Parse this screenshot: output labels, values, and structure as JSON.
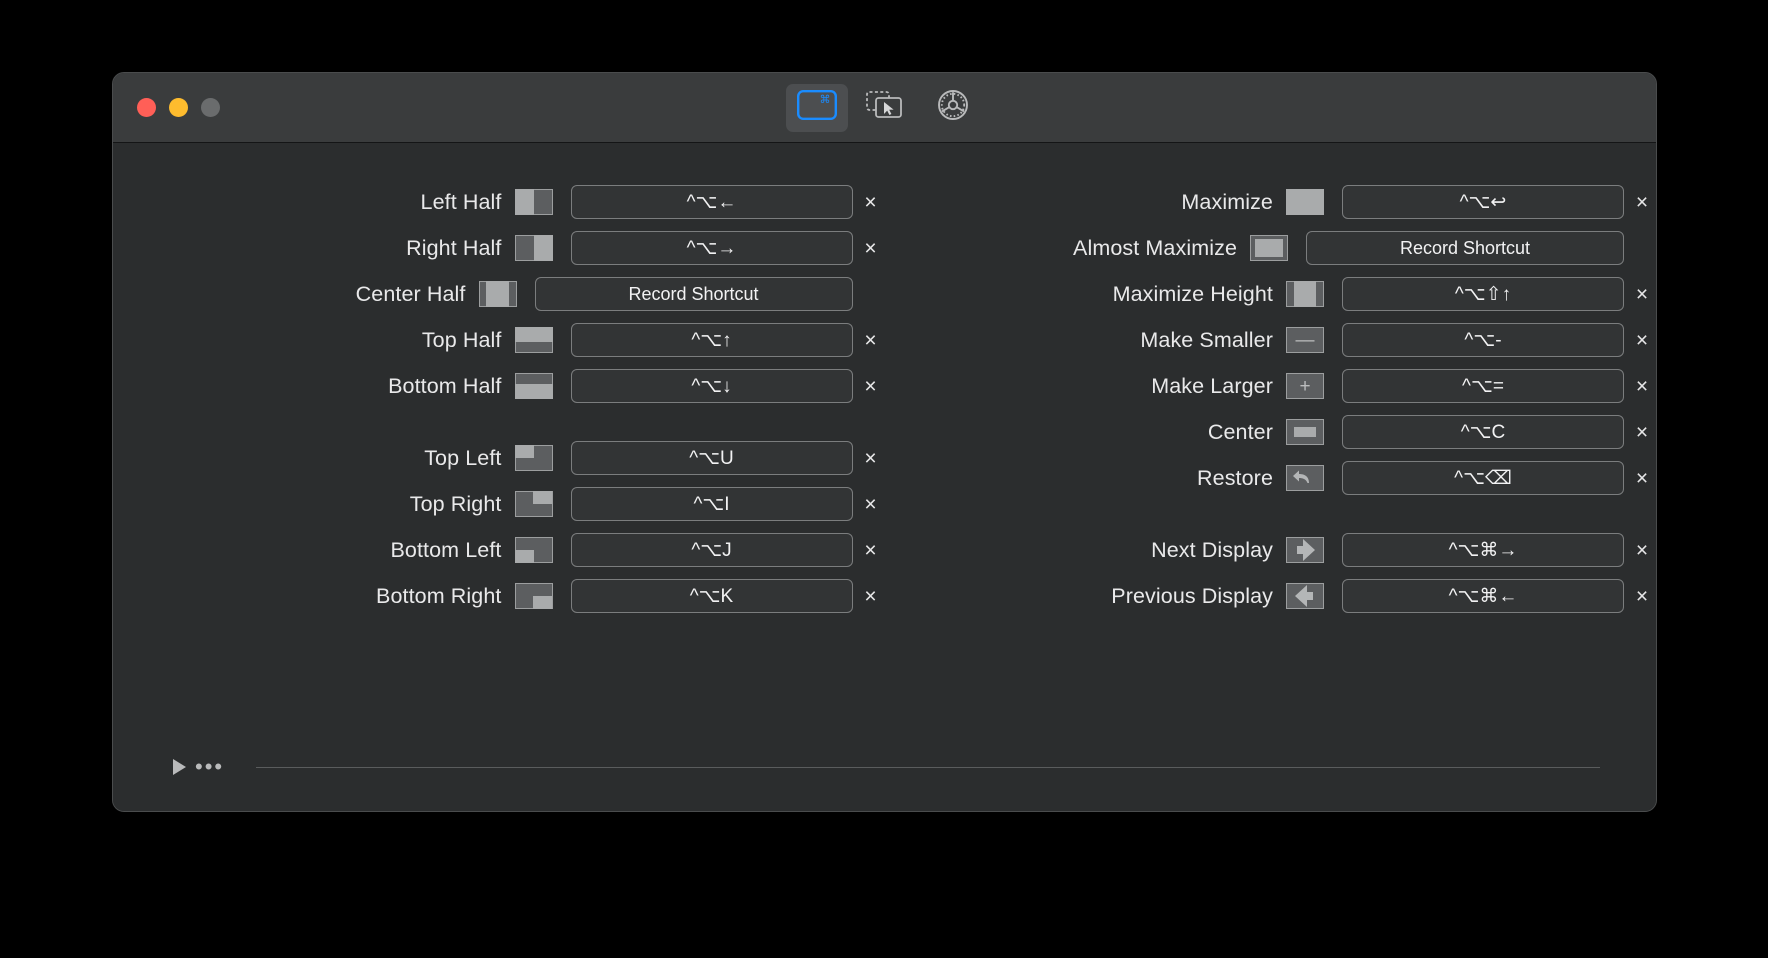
{
  "window": {
    "traffic_lights": [
      "close",
      "minimize",
      "zoom"
    ],
    "toolbar": [
      {
        "name": "window-snapping-tab",
        "icon": "window-command-icon",
        "selected": true
      },
      {
        "name": "window-mouse-tab",
        "icon": "windows-cursor-icon",
        "selected": false
      },
      {
        "name": "preferences-tab",
        "icon": "gear-icon",
        "selected": false
      }
    ]
  },
  "left_column": [
    {
      "label": "Left Half",
      "icon": "left-half-icon",
      "shortcut": "^⌥←",
      "recorded": true
    },
    {
      "label": "Right Half",
      "icon": "right-half-icon",
      "shortcut": "^⌥→",
      "recorded": true
    },
    {
      "label": "Center Half",
      "icon": "center-half-icon",
      "shortcut": "Record Shortcut",
      "recorded": false
    },
    {
      "label": "Top Half",
      "icon": "top-half-icon",
      "shortcut": "^⌥↑",
      "recorded": true
    },
    {
      "label": "Bottom Half",
      "icon": "bottom-half-icon",
      "shortcut": "^⌥↓",
      "recorded": true
    },
    {
      "label": "",
      "icon": "spacer",
      "shortcut": "",
      "recorded": false,
      "spacer": true
    },
    {
      "label": "Top Left",
      "icon": "top-left-icon",
      "shortcut": "^⌥U",
      "recorded": true
    },
    {
      "label": "Top Right",
      "icon": "top-right-icon",
      "shortcut": "^⌥I",
      "recorded": true
    },
    {
      "label": "Bottom Left",
      "icon": "bottom-left-icon",
      "shortcut": "^⌥J",
      "recorded": true
    },
    {
      "label": "Bottom Right",
      "icon": "bottom-right-icon",
      "shortcut": "^⌥K",
      "recorded": true
    }
  ],
  "right_column": [
    {
      "label": "Maximize",
      "icon": "maximize-icon",
      "shortcut": "^⌥↩",
      "recorded": true
    },
    {
      "label": "Almost Maximize",
      "icon": "almost-maximize-icon",
      "shortcut": "Record Shortcut",
      "recorded": false
    },
    {
      "label": "Maximize Height",
      "icon": "maximize-height-icon",
      "shortcut": "^⌥⇧↑",
      "recorded": true
    },
    {
      "label": "Make Smaller",
      "icon": "make-smaller-icon",
      "shortcut": "^⌥-",
      "recorded": true
    },
    {
      "label": "Make Larger",
      "icon": "make-larger-icon",
      "shortcut": "^⌥=",
      "recorded": true
    },
    {
      "label": "Center",
      "icon": "center-icon",
      "shortcut": "^⌥C",
      "recorded": true
    },
    {
      "label": "Restore",
      "icon": "restore-icon",
      "shortcut": "^⌥⌫",
      "recorded": true
    },
    {
      "label": "",
      "icon": "spacer",
      "shortcut": "",
      "recorded": false,
      "spacer": true
    },
    {
      "label": "Next Display",
      "icon": "next-display-icon",
      "shortcut": "^⌥⌘→",
      "recorded": true
    },
    {
      "label": "Previous Display",
      "icon": "previous-display-icon",
      "shortcut": "^⌥⌘←",
      "recorded": true
    }
  ],
  "footer": {
    "disclosure": "disclosure-triangle",
    "ellipsis": "•••"
  },
  "colors": {
    "window_bg": "#2b2d2e",
    "titlebar_bg": "#3a3c3d",
    "accent": "#1a8cff",
    "close": "#ff5f57",
    "minimize": "#febc2e",
    "zoom": "#6a6c6d",
    "text": "#e9e9ea",
    "border": "#7b7d7e"
  },
  "clear_glyph": "×"
}
